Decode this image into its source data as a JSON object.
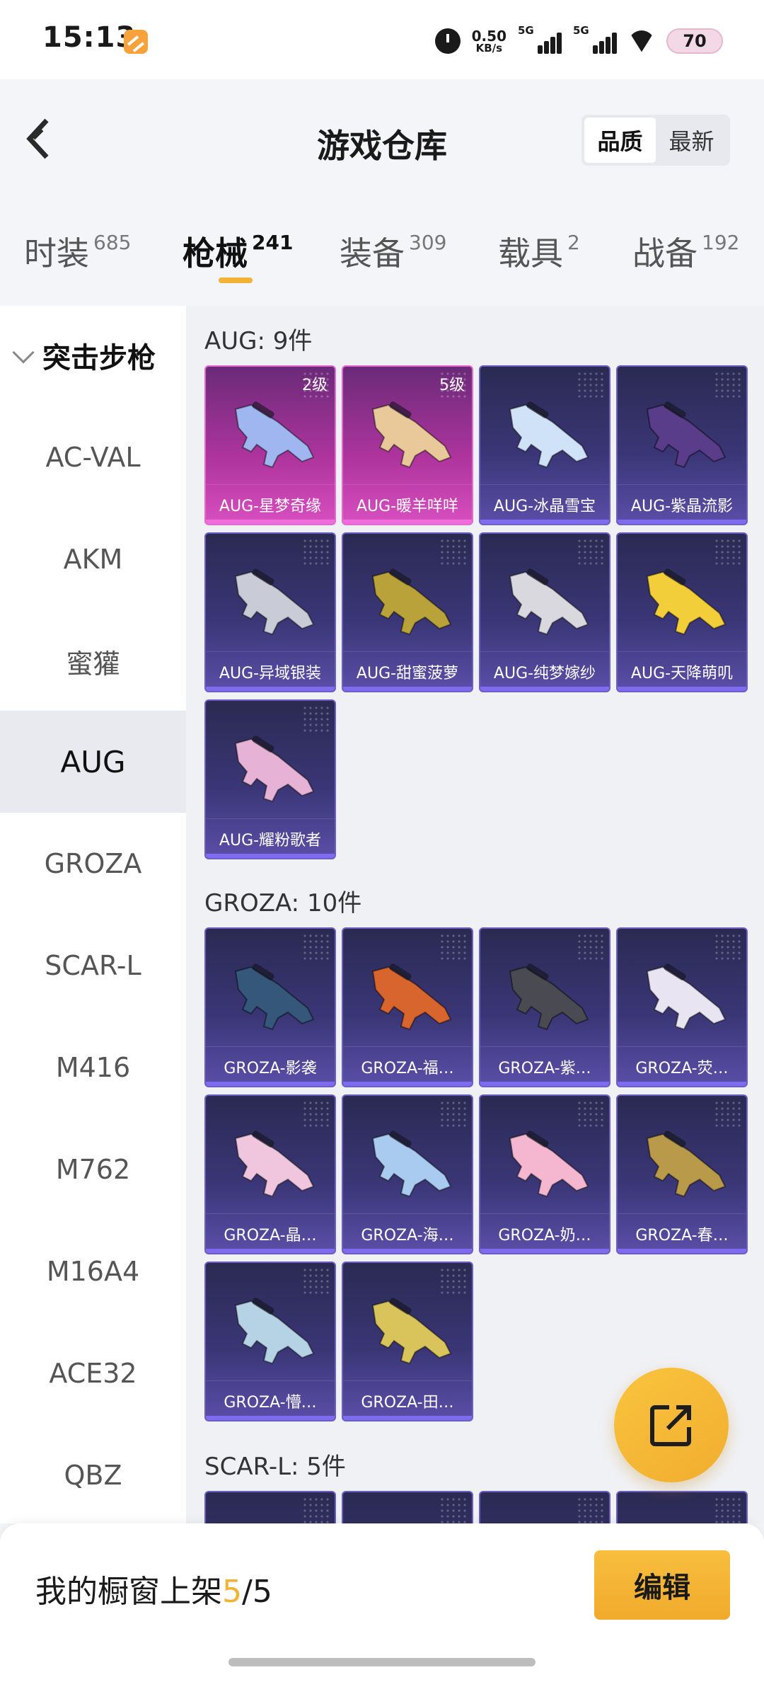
{
  "status_bar": {
    "time": "15:13",
    "net_speed_value": "0.50",
    "net_speed_unit": "KB/s",
    "sim1_label": "5G",
    "sim2_label": "5G",
    "battery": "70"
  },
  "header": {
    "back_icon": "chevron-left-icon",
    "title": "游戏仓库",
    "sort_options": [
      {
        "label": "品质",
        "active": true
      },
      {
        "label": "最新",
        "active": false
      }
    ]
  },
  "category_tabs": [
    {
      "name": "时装",
      "count": "685",
      "active": false
    },
    {
      "name": "枪械",
      "count": "241",
      "active": true
    },
    {
      "name": "装备",
      "count": "309",
      "active": false
    },
    {
      "name": "载具",
      "count": "2",
      "active": false
    },
    {
      "name": "战备",
      "count": "192",
      "active": false
    }
  ],
  "sidebar": {
    "group_label": "突击步枪",
    "items": [
      {
        "label": "AC-VAL",
        "active": false
      },
      {
        "label": "AKM",
        "active": false
      },
      {
        "label": "蜜獾",
        "active": false
      },
      {
        "label": "AUG",
        "active": true
      },
      {
        "label": "GROZA",
        "active": false
      },
      {
        "label": "SCAR-L",
        "active": false
      },
      {
        "label": "M416",
        "active": false
      },
      {
        "label": "M762",
        "active": false
      },
      {
        "label": "M16A4",
        "active": false
      },
      {
        "label": "ACE32",
        "active": false
      },
      {
        "label": "QBZ",
        "active": false
      }
    ]
  },
  "sections": [
    {
      "title": "AUG: 9件",
      "items": [
        {
          "name": "AUG-星梦奇缘",
          "level": "2级",
          "rarity": "legend",
          "color": "#9fb6f0"
        },
        {
          "name": "AUG-暖羊咩咩",
          "level": "5级",
          "rarity": "legend",
          "color": "#e9c89a"
        },
        {
          "name": "AUG-冰晶雪宝",
          "level": "",
          "rarity": "epic",
          "color": "#cfe2f7"
        },
        {
          "name": "AUG-紫晶流影",
          "level": "",
          "rarity": "epic",
          "color": "#5a3d8a"
        },
        {
          "name": "AUG-异域银装",
          "level": "",
          "rarity": "epic",
          "color": "#c9ccd6"
        },
        {
          "name": "AUG-甜蜜菠萝",
          "level": "",
          "rarity": "epic",
          "color": "#b9a23a"
        },
        {
          "name": "AUG-纯梦嫁纱",
          "level": "",
          "rarity": "epic",
          "color": "#d8d8de"
        },
        {
          "name": "AUG-天降萌叽",
          "level": "",
          "rarity": "epic",
          "color": "#f2cf3a"
        },
        {
          "name": "AUG-耀粉歌者",
          "level": "",
          "rarity": "epic",
          "color": "#e6b3d6"
        }
      ]
    },
    {
      "title": "GROZA: 10件",
      "items": [
        {
          "name": "GROZA-影袭",
          "level": "",
          "rarity": "epic",
          "color": "#35577a"
        },
        {
          "name": "GROZA-福…",
          "level": "",
          "rarity": "epic",
          "color": "#d9652e"
        },
        {
          "name": "GROZA-紫…",
          "level": "",
          "rarity": "epic",
          "color": "#4a4a52"
        },
        {
          "name": "GROZA-荧…",
          "level": "",
          "rarity": "epic",
          "color": "#e8e4f2"
        },
        {
          "name": "GROZA-晶…",
          "level": "",
          "rarity": "epic",
          "color": "#f0c6de"
        },
        {
          "name": "GROZA-海…",
          "level": "",
          "rarity": "epic",
          "color": "#a9cbef"
        },
        {
          "name": "GROZA-奶…",
          "level": "",
          "rarity": "epic",
          "color": "#f4b7cf"
        },
        {
          "name": "GROZA-春…",
          "level": "",
          "rarity": "epic",
          "color": "#b89a4a"
        },
        {
          "name": "GROZA-懵…",
          "level": "",
          "rarity": "epic",
          "color": "#b6d3e6"
        },
        {
          "name": "GROZA-田…",
          "level": "",
          "rarity": "epic",
          "color": "#d8c45a"
        }
      ]
    },
    {
      "title": "SCAR-L: 5件",
      "items": [
        {
          "name": "",
          "level": "",
          "rarity": "epic",
          "color": "#3a3a4a"
        },
        {
          "name": "",
          "level": "",
          "rarity": "epic",
          "color": "#3a3a4a"
        },
        {
          "name": "",
          "level": "",
          "rarity": "epic",
          "color": "#3a3a4a"
        },
        {
          "name": "",
          "level": "",
          "rarity": "epic",
          "color": "#3a3a4a"
        }
      ]
    }
  ],
  "fab_icon": "share-external-icon",
  "bottom_bar": {
    "showcase_prefix": "我的橱窗上架",
    "showcase_current": "5",
    "showcase_sep": "/",
    "showcase_total": "5",
    "edit_label": "编辑"
  },
  "colors": {
    "accent": "#f2b233",
    "legend_card": "#c540ad",
    "epic_card": "#3a3676"
  }
}
